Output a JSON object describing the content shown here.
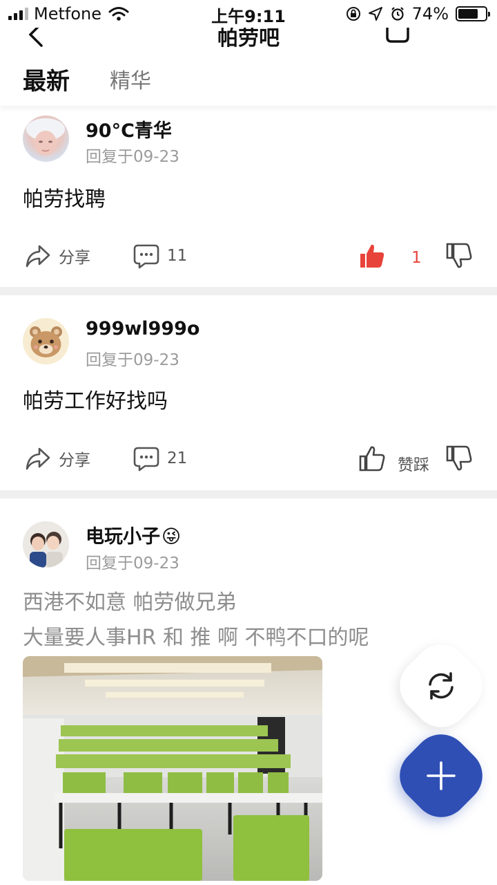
{
  "status_bar": {
    "carrier": "Metfone",
    "time": "上午9:11",
    "battery": "74%",
    "battery_level": 0.74
  },
  "nav": {
    "title": "帕劳吧"
  },
  "tabs": [
    {
      "label": "最新",
      "active": true
    },
    {
      "label": "精华",
      "active": false
    }
  ],
  "posts": [
    {
      "username": "90°C青华",
      "meta": "回复于09-23",
      "content_lines": [
        "帕劳找聘"
      ],
      "share_label": "分享",
      "comment_count": "11",
      "like_label": "1",
      "liked": true
    },
    {
      "username": "999wl999o",
      "meta": "回复于09-23",
      "content_lines": [
        "帕劳工作好找吗"
      ],
      "share_label": "分享",
      "comment_count": "21",
      "like_label": "赞踩",
      "liked": false
    },
    {
      "username": "电玩小子",
      "username_emoji": "😜",
      "meta": "回复于09-23",
      "content_lines": [
        "西港不如意 帕劳做兄弟",
        "大量要人事HR 和 推 啊 不鸭不口的呢"
      ]
    }
  ],
  "colors": {
    "accent_blue": "#2f4fb5",
    "like_red": "#e8433a",
    "divider": "#efefef",
    "meta_gray": "#9b9b9b"
  },
  "icons": [
    "back-icon",
    "bell-icon",
    "share-icon",
    "comment-icon",
    "thumb-up-icon",
    "thumb-down-icon",
    "refresh-icon",
    "plus-icon"
  ]
}
